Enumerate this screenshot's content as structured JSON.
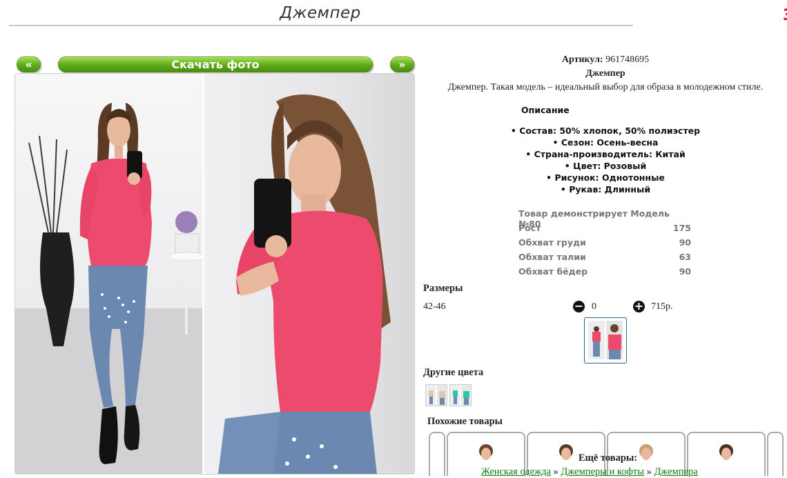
{
  "header": {
    "title": "Джемпер",
    "corner_mark": "3"
  },
  "gallery": {
    "prev_label": "«",
    "download_label": "Скачать фото",
    "next_label": "»"
  },
  "product": {
    "sku_label": "Артикул:",
    "sku_value": "961748695",
    "name": "Джемпер",
    "short_description": "Джемпер. Такая модель – идеальный выбор для образа в молодежном стиле.",
    "description_heading": "Описание",
    "attributes": [
      "• Состав: 50% хлопок, 50% полиэстер",
      "• Сезон: Осень-весна",
      "• Страна-производитель: Китай",
      "• Цвет: Розовый",
      "• Рисунок: Однотонные",
      "• Рукав: Длинный"
    ]
  },
  "model": {
    "heading": "Товар демонстрирует Модель №80",
    "rows": [
      {
        "label": "Рост",
        "value": "175"
      },
      {
        "label": "Обхват груди",
        "value": "90"
      },
      {
        "label": "Обхват талии",
        "value": "63"
      },
      {
        "label": "Обхват бёдер",
        "value": "90"
      }
    ]
  },
  "order": {
    "sizes_heading": "Размеры",
    "size_range": "42-46",
    "minus_icon": "minus-circle-icon",
    "minus_glyph": "−",
    "quantity": "0",
    "plus_icon": "plus-circle-icon",
    "plus_glyph": "+",
    "price": "715р."
  },
  "other_colors": {
    "heading": "Другие цвета"
  },
  "similar": {
    "heading": "Похожие товары"
  },
  "footer": {
    "more_label": "Ещё товары:",
    "breadcrumb": [
      "Женская одежда",
      "Джемперы и кофты",
      "Джемпера"
    ],
    "separator": "»"
  },
  "colors": {
    "button_green": "#5fa81b",
    "link_green": "#107a10",
    "sweater_pink": "#ec4b6e",
    "teal_variant": "#2ec6a8"
  }
}
